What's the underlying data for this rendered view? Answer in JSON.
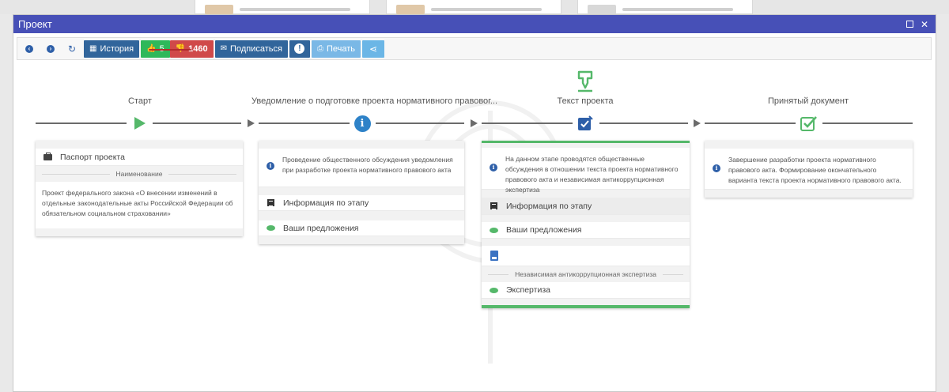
{
  "window": {
    "title": "Проект"
  },
  "toolbar": {
    "history_label": "История",
    "likes_count": "5",
    "dislikes_count": "1460",
    "subscribe_label": "Подписаться",
    "print_label": "Печать"
  },
  "stages": [
    {
      "title": "Старт",
      "passport_label": "Паспорт проекта",
      "name_header": "Наименование",
      "name_text": "Проект федерального закона «О внесении изменений в отдельные законодательные акты Российской Федерации об обязательном социальном страховании»"
    },
    {
      "title": "Уведомление о подготовке проекта нормативного правовог...",
      "description": "Проведение общественного обсуждения уведомления при разработке проекта нормативного правового акта",
      "info_label": "Информация по этапу",
      "proposals_label": "Ваши предложения"
    },
    {
      "title": "Текст проекта",
      "description": "На данном этапе проводятся общественные обсуждения в отношении текста проекта нормативного правового акта и независимая антикоррупционная экспертиза",
      "info_label": "Информация по этапу",
      "proposals_label": "Ваши предложения",
      "anticorruption_header": "Независимая антикоррупционная экспертиза",
      "expertise_label": "Экспертиза"
    },
    {
      "title": "Принятый документ",
      "description": "Завершение разработки проекта нормативного правового акта. Формирование окончательного варианта текста проекта нормативного правового акта."
    }
  ],
  "colors": {
    "titlebar": "#4750b7",
    "primary_button": "#31659b",
    "like": "#2fb85a",
    "dislike": "#d04949",
    "stage_active": "#55b86a"
  }
}
